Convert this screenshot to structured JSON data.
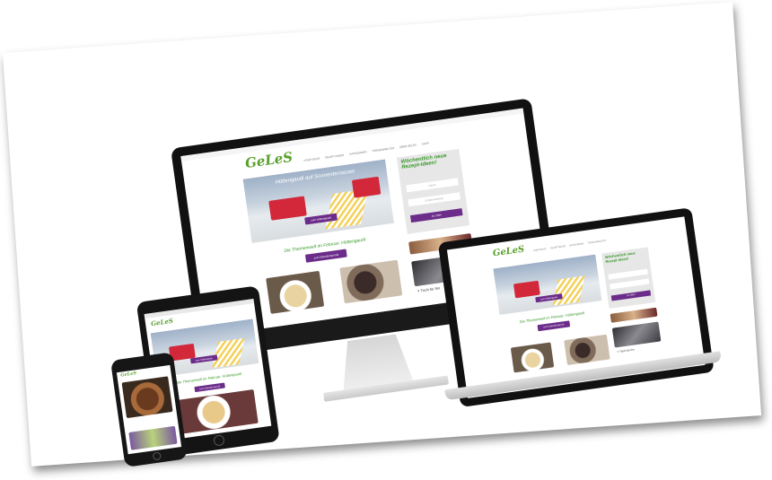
{
  "site": {
    "logo": "GeLeS",
    "hero_text": "Hüttengaudi auf Sonnenterrassen",
    "hero_button": "zum Hüttengaudi",
    "headline": "Die Themenwelt im Februar: Hüttengaudi",
    "cta_button": "zum Kalenderspecial",
    "sidebar_title": "Wöchentlich neue Rezept-Ideen!",
    "sidebar_field_name": "Name",
    "sidebar_field_email": "E-Mail-Adresse",
    "sidebar_button": "Ja, bitte!",
    "tag_snippet": "Y Tisch für Ihn",
    "laptop_tag_snippet": "Y Tisch für Ihn",
    "nav_items": [
      "STARTSEITE",
      "REZEPTIDEEN",
      "KATEGORIEN",
      "THEMENWELTEN",
      "ÜBER GELES",
      "SHOP"
    ]
  },
  "colors": {
    "brand_green": "#3a9a2a",
    "brand_purple": "#6b2c8a",
    "device_black": "#111111"
  }
}
